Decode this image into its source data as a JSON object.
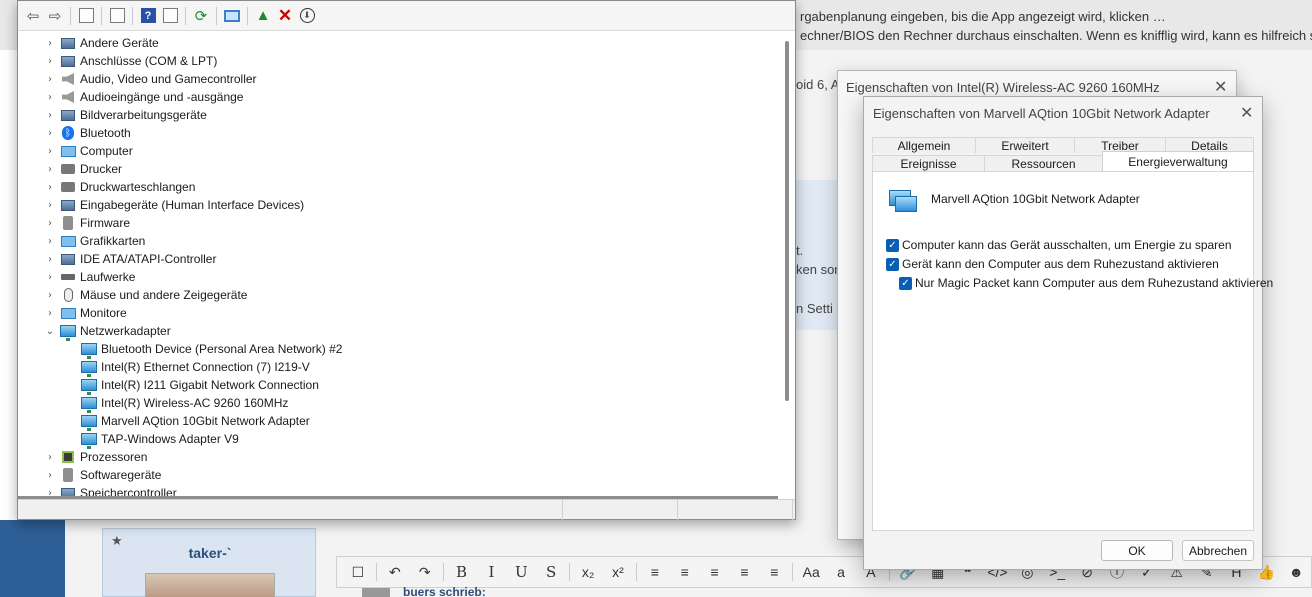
{
  "background": {
    "top_line_1": "rgabenplanung eingeben, bis die App angezeigt wird, klicken …",
    "top_line_2": "echner/BIOS den Rechner durchaus einschalten. Wenn es knifflig wird, kann es hilfreich s",
    "fragment_1": "oid 6, A",
    "fragment_2": "t.",
    "fragment_3": "ken son",
    "fragment_4": "n Setti",
    "post_username": "taker-`",
    "quote_text": "buers schrieb:",
    "editor_buttons": [
      "☐",
      "↶",
      "↷",
      "B",
      "I",
      "U",
      "S",
      "x₂",
      "x²",
      "≡",
      "≡",
      "≡",
      "≡",
      "≡",
      "Aa",
      "a",
      "A",
      "🔗",
      "▦",
      "❝",
      "</>",
      "◎",
      ">_",
      "⊘",
      "ⓘ",
      "✓",
      "⚠",
      "✎",
      "H",
      "👍",
      "☻"
    ]
  },
  "device_manager": {
    "toolbar_icons": [
      "back-arrow-icon",
      "forward-arrow-icon",
      "properties-icon",
      "view-icon",
      "help-icon",
      "details-icon",
      "update-icon",
      "scan-icon",
      "enable-icon",
      "uninstall-icon",
      "disable-icon"
    ],
    "tree": [
      {
        "label": "Andere Geräte",
        "expanded": false,
        "icon": "unknown-device-icon"
      },
      {
        "label": "Anschlüsse (COM & LPT)",
        "expanded": false,
        "icon": "port-icon"
      },
      {
        "label": "Audio, Video und Gamecontroller",
        "expanded": false,
        "icon": "speaker-icon"
      },
      {
        "label": "Audioeingänge und -ausgänge",
        "expanded": false,
        "icon": "speaker-icon"
      },
      {
        "label": "Bildverarbeitungsgeräte",
        "expanded": false,
        "icon": "camera-icon"
      },
      {
        "label": "Bluetooth",
        "expanded": false,
        "icon": "bluetooth-icon"
      },
      {
        "label": "Computer",
        "expanded": false,
        "icon": "monitor-icon"
      },
      {
        "label": "Drucker",
        "expanded": false,
        "icon": "printer-icon"
      },
      {
        "label": "Druckwarteschlangen",
        "expanded": false,
        "icon": "printer-icon"
      },
      {
        "label": "Eingabegeräte (Human Interface Devices)",
        "expanded": false,
        "icon": "hid-icon"
      },
      {
        "label": "Firmware",
        "expanded": false,
        "icon": "firmware-icon"
      },
      {
        "label": "Grafikkarten",
        "expanded": false,
        "icon": "monitor-icon"
      },
      {
        "label": "IDE ATA/ATAPI-Controller",
        "expanded": false,
        "icon": "controller-icon"
      },
      {
        "label": "Laufwerke",
        "expanded": false,
        "icon": "drive-icon"
      },
      {
        "label": "Mäuse und andere Zeigegeräte",
        "expanded": false,
        "icon": "mouse-icon"
      },
      {
        "label": "Monitore",
        "expanded": false,
        "icon": "monitor-icon"
      },
      {
        "label": "Netzwerkadapter",
        "expanded": true,
        "icon": "network-icon"
      }
    ],
    "network_children": [
      "Bluetooth Device (Personal Area Network) #2",
      "Intel(R) Ethernet Connection (7) I219-V",
      "Intel(R) I211 Gigabit Network Connection",
      "Intel(R) Wireless-AC 9260 160MHz",
      "Marvell AQtion 10Gbit Network Adapter",
      "TAP-Windows Adapter V9"
    ],
    "tree_after": [
      {
        "label": "Prozessoren",
        "icon": "cpu-icon"
      },
      {
        "label": "Softwaregeräte",
        "icon": "software-device-icon"
      },
      {
        "label": "Speichercontroller",
        "icon": "storage-controller-icon"
      }
    ]
  },
  "dialog_back": {
    "title": "Eigenschaften von Intel(R) Wireless-AC 9260 160MHz"
  },
  "dialog": {
    "title": "Eigenschaften von Marvell AQtion 10Gbit Network Adapter",
    "tabs_row1": [
      "Allgemein",
      "Erweitert",
      "Treiber",
      "Details"
    ],
    "tabs_row2": [
      "Ereignisse",
      "Ressourcen",
      "Energieverwaltung"
    ],
    "active_tab": "Energieverwaltung",
    "device_name": "Marvell AQtion 10Gbit Network Adapter",
    "options": [
      {
        "label": "Computer kann das Gerät ausschalten, um Energie zu sparen",
        "checked": true
      },
      {
        "label": "Gerät kann den Computer aus dem Ruhezustand aktivieren",
        "checked": true
      },
      {
        "label": "Nur Magic Packet kann Computer aus dem Ruhezustand aktivieren",
        "checked": true
      }
    ],
    "ok_label": "OK",
    "cancel_label": "Abbrechen"
  }
}
